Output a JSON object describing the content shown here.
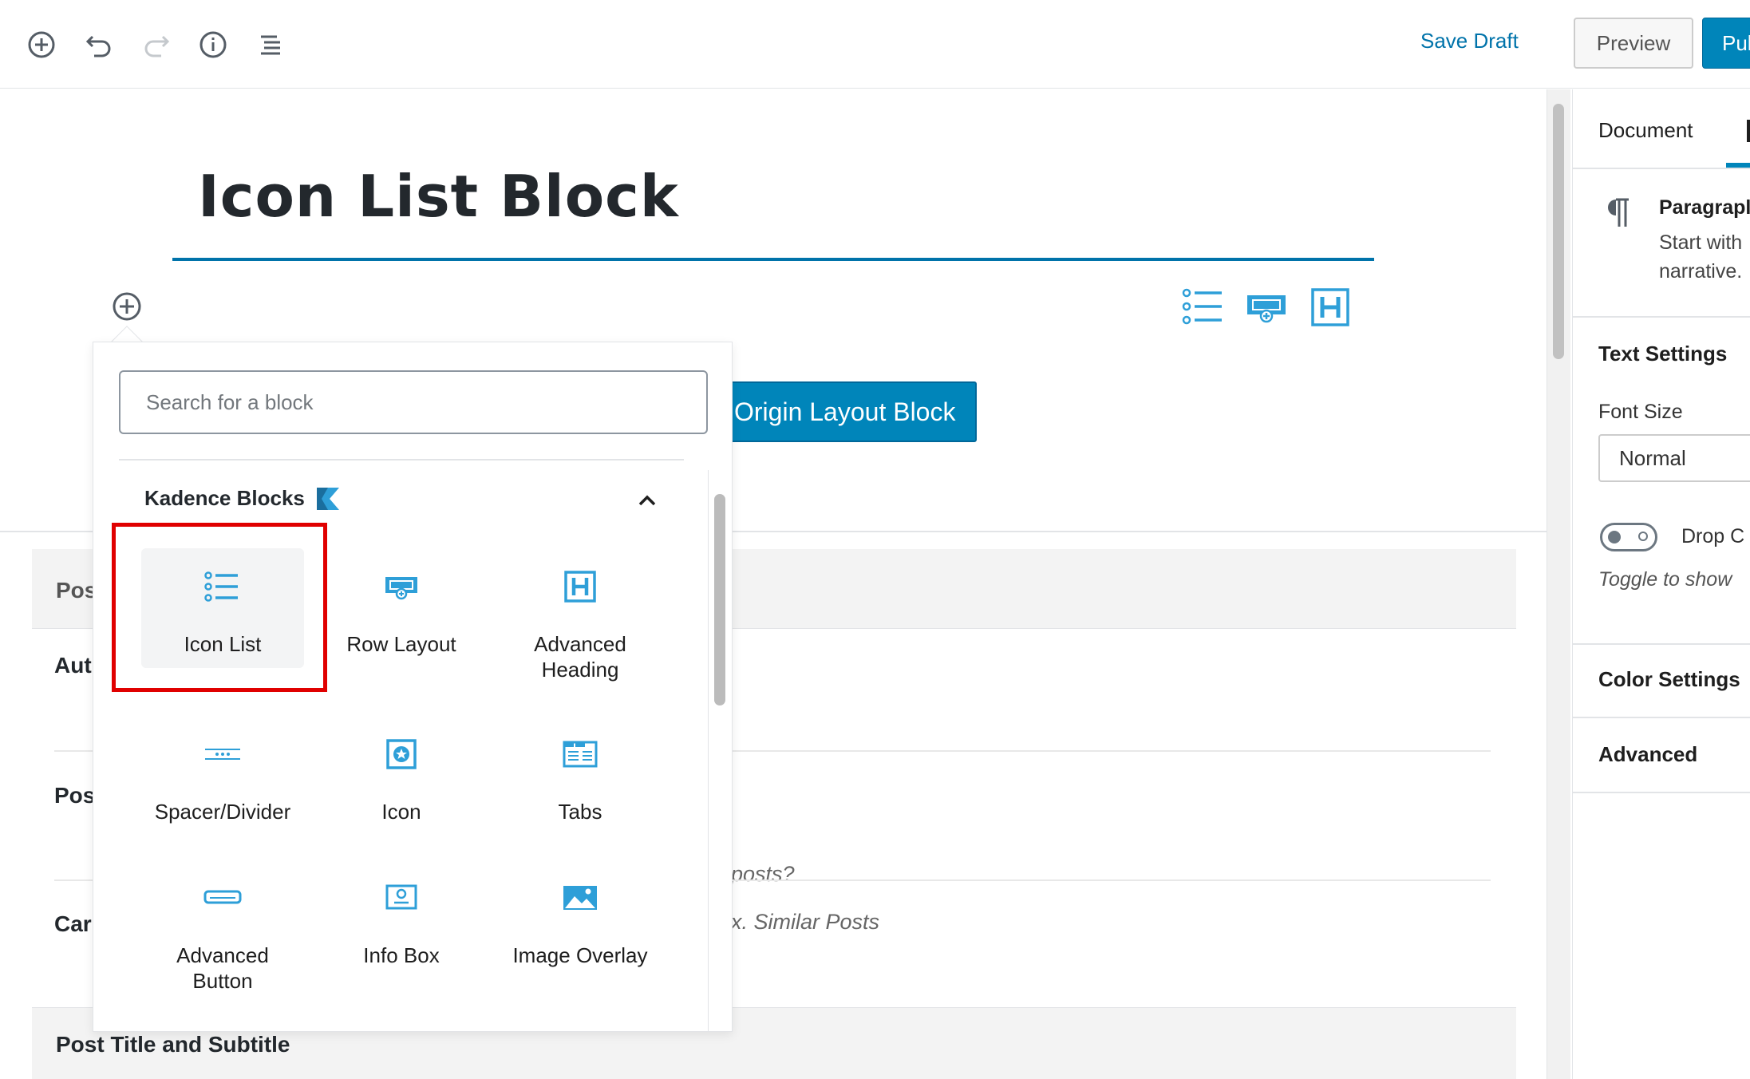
{
  "toolbar": {
    "save_draft": "Save Draft",
    "preview": "Preview",
    "publish": "Pul",
    "icons": [
      "add-block-icon",
      "undo-icon",
      "redo-icon",
      "info-icon",
      "block-navigation-icon"
    ]
  },
  "editor": {
    "post_title": "Icon List Block",
    "origin_button": "Origin Layout Block",
    "quick_inserter_icons": [
      "icon-list-icon",
      "row-layout-icon",
      "advanced-heading-icon"
    ]
  },
  "inserter": {
    "search_placeholder": "Search for a block",
    "category": "Kadence Blocks",
    "blocks": [
      {
        "label": "Icon List",
        "icon": "icon-list-icon"
      },
      {
        "label": "Row Layout",
        "icon": "row-layout-icon"
      },
      {
        "label": "Advanced Heading",
        "icon": "advanced-heading-icon"
      },
      {
        "label": "Spacer/Divider",
        "icon": "spacer-divider-icon"
      },
      {
        "label": "Icon",
        "icon": "icon-block-icon"
      },
      {
        "label": "Tabs",
        "icon": "tabs-icon"
      },
      {
        "label": "Advanced Button",
        "icon": "advanced-button-icon"
      },
      {
        "label": "Info Box",
        "icon": "info-box-icon"
      },
      {
        "label": "Image Overlay",
        "icon": "image-overlay-icon"
      }
    ]
  },
  "meta": {
    "header_partial": "Pos",
    "row1_label_partial": "Aut",
    "row2_label_partial": "Pos",
    "row2_hint_partial": "posts?",
    "row3_label_partial": "Car",
    "row3_hint_partial": "x. Similar Posts",
    "footer_title": "Post Title and Subtitle"
  },
  "sidebar": {
    "tab_document": "Document",
    "paragraph_title": "Paragrapl",
    "paragraph_desc_1": "Start with",
    "paragraph_desc_2": "narrative.",
    "text_settings": "Text Settings",
    "font_size_label": "Font Size",
    "font_size_value": "Normal",
    "drop_cap": "Drop C",
    "toggle_hint": "Toggle to show",
    "color_settings": "Color Settings",
    "advanced": "Advanced"
  },
  "colors": {
    "accent": "#0085ba",
    "link": "#0073aa",
    "highlight": "#e00000"
  }
}
